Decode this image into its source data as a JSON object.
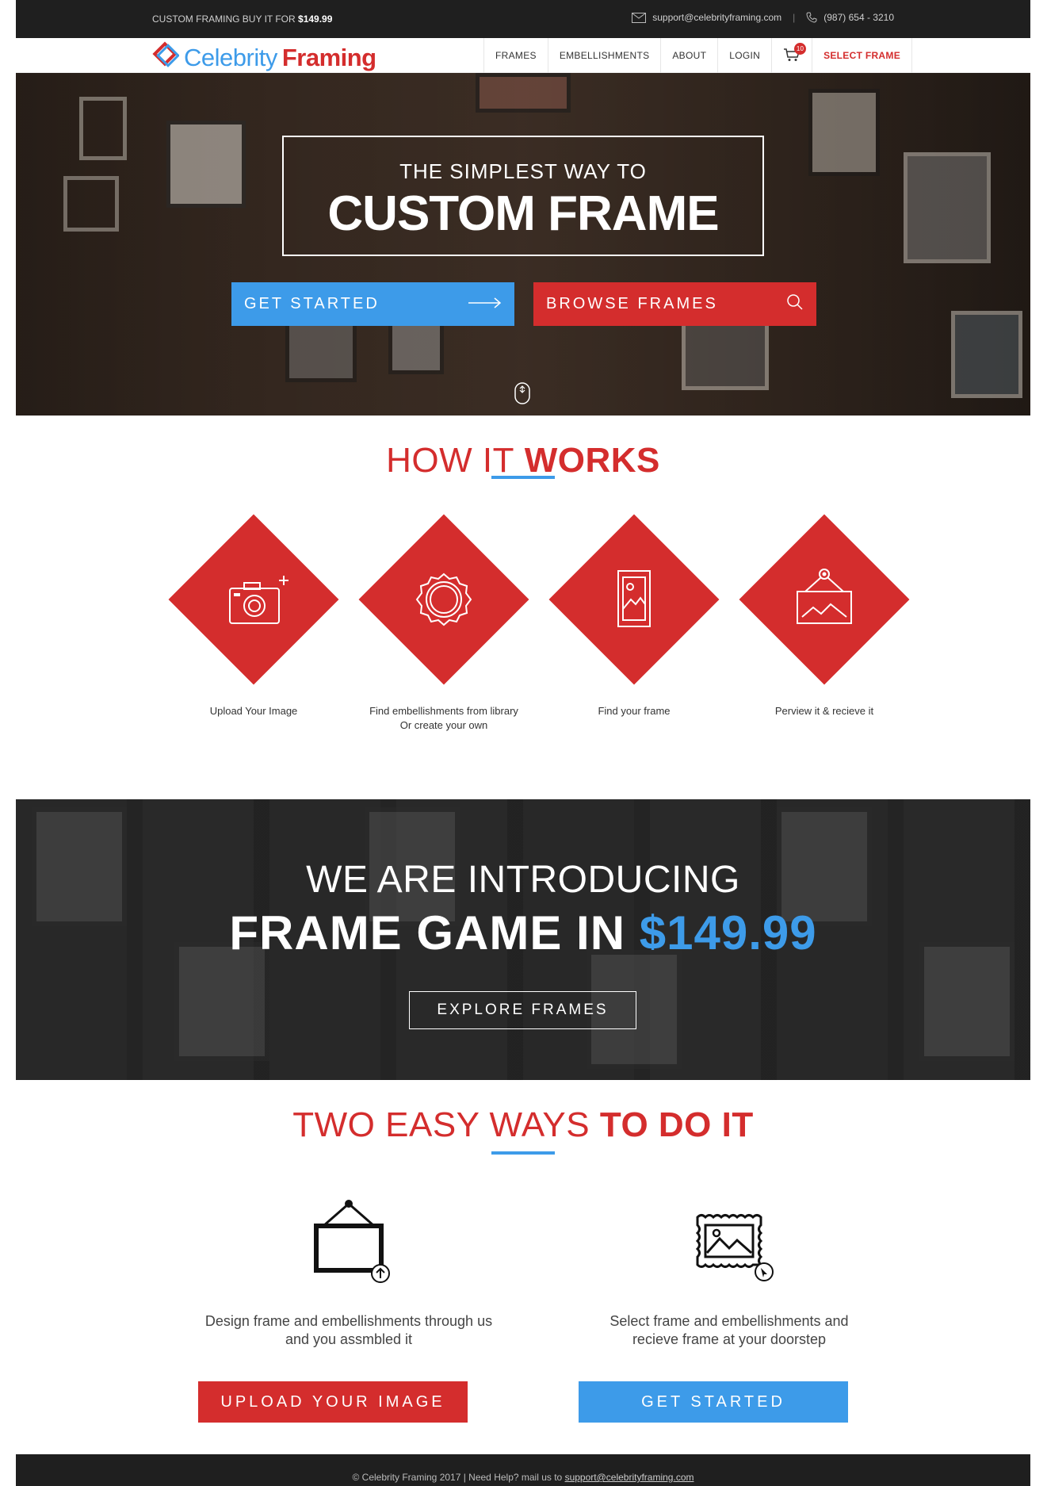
{
  "topbar": {
    "promo_text": "CUSTOM FRAMING BUY IT FOR",
    "promo_price": "$149.99",
    "email": "support@celebrityframing.com",
    "separator": "|",
    "phone": "(987) 654 - 3210"
  },
  "brand": {
    "name_part1": "Celebrity",
    "name_part2": "Framing"
  },
  "nav": {
    "items": [
      "FRAMES",
      "EMBELLISHMENTS",
      "ABOUT",
      "LOGIN"
    ],
    "cart_count": "10",
    "cta": "SELECT FRAME"
  },
  "hero": {
    "subtitle": "THE SIMPLEST WAY TO",
    "title": "CUSTOM FRAME",
    "get_started": "GET STARTED",
    "browse": "BROWSE FRAMES"
  },
  "how": {
    "title_light": "HOW IT",
    "title_bold": "WORKS",
    "steps": [
      {
        "label": "Upload Your Image",
        "label2": "",
        "icon": "camera-plus-icon"
      },
      {
        "label": "Find embellishments from library",
        "label2": "Or create your own",
        "icon": "badge-seal-icon"
      },
      {
        "label": "Find your frame",
        "label2": "",
        "icon": "picture-frame-icon"
      },
      {
        "label": "Perview it & recieve it",
        "label2": "",
        "icon": "hanging-picture-icon"
      }
    ]
  },
  "banner": {
    "line1": "WE ARE INTRODUCING",
    "line2": "FRAME GAME IN",
    "price": "$149.99",
    "explore": "EXPLORE FRAMES"
  },
  "ways": {
    "title_light": "TWO EASY WAYS",
    "title_bold": "TO DO IT",
    "left": {
      "line1": "Design frame and embellishments through us",
      "line2": "and you assmbled it",
      "button": "UPLOAD YOUR IMAGE"
    },
    "right": {
      "line1": "Select frame and embellishments and",
      "line2": "recieve frame at your doorstep",
      "button": "GET STARTED"
    }
  },
  "footer": {
    "text": "© Celebrity Framing 2017 | Need Help? mail us to",
    "email": "support@celebrityframing.com"
  },
  "colors": {
    "accent_red": "#d42d2d",
    "accent_blue": "#3d9be9",
    "dark": "#1f1f1f"
  }
}
